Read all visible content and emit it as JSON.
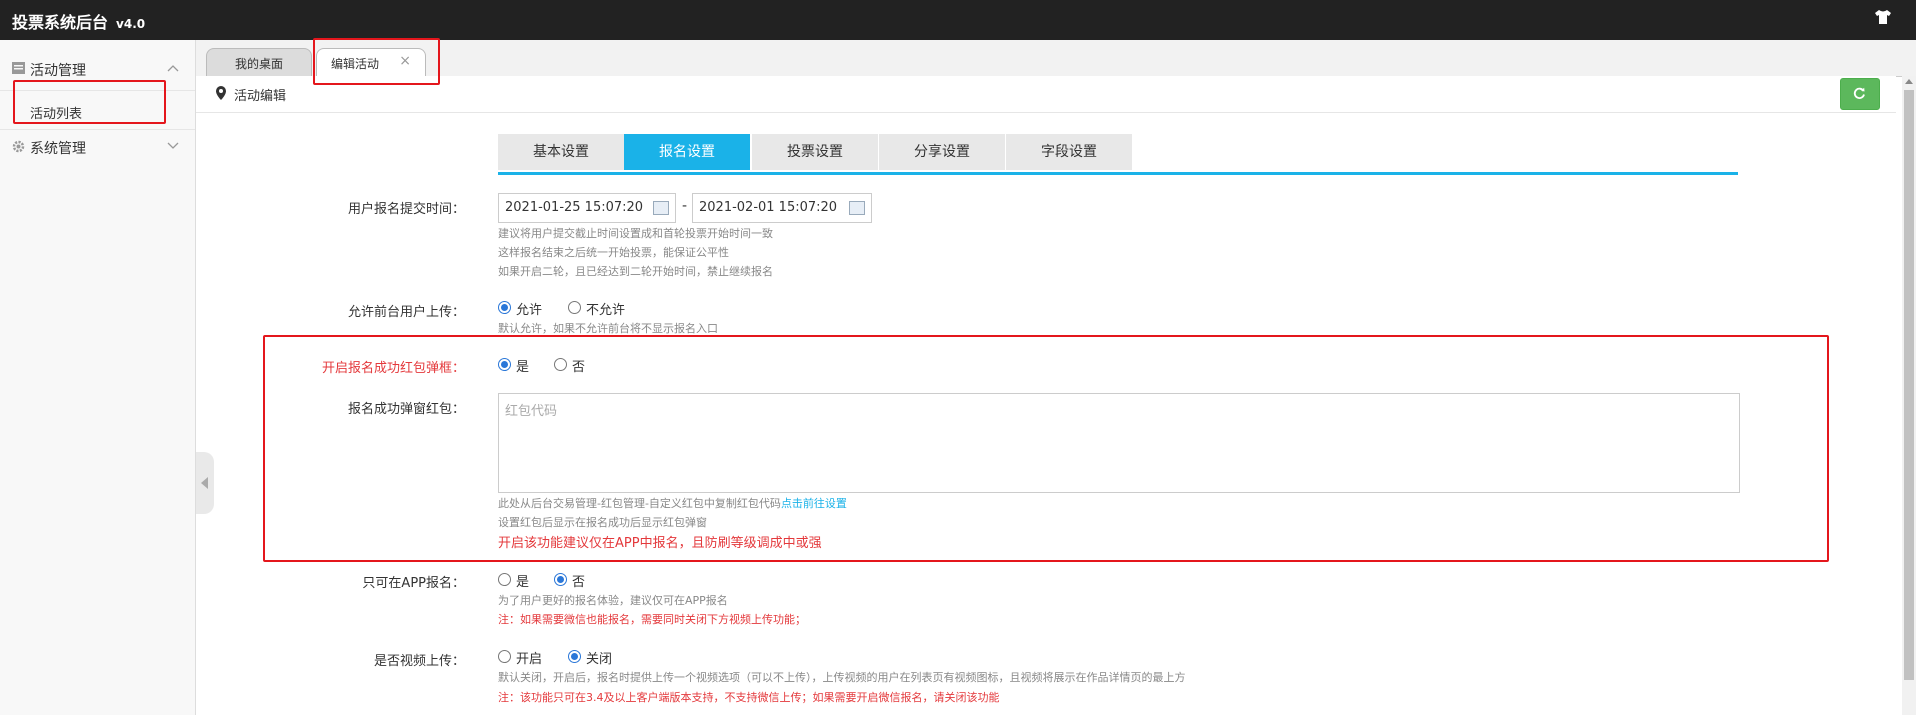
{
  "app": {
    "title": "投票系统后台",
    "version": "v4.0"
  },
  "sidebar": {
    "groups": [
      {
        "label": "活动管理",
        "items": [
          {
            "label": "活动列表"
          }
        ]
      },
      {
        "label": "系统管理"
      }
    ]
  },
  "tabs": [
    {
      "label": "我的桌面"
    },
    {
      "label": "编辑活动",
      "close": "×"
    }
  ],
  "page": {
    "breadcrumb": "活动编辑"
  },
  "section_tabs": [
    {
      "label": "基本设置",
      "active": false
    },
    {
      "label": "报名设置",
      "active": true
    },
    {
      "label": "投票设置",
      "active": false
    },
    {
      "label": "分享设置",
      "active": false
    },
    {
      "label": "字段设置",
      "active": false
    }
  ],
  "form": {
    "submit_time": {
      "label": "用户报名提交时间：",
      "start": "2021-01-25 15:07:20",
      "sep": "-",
      "end": "2021-02-01 15:07:20",
      "help": [
        "建议将用户提交截止时间设置成和首轮投票开始时间一致",
        "这样报名结束之后统一开始投票，能保证公平性",
        "如果开启二轮，且已经达到二轮开始时间，禁止继续报名"
      ]
    },
    "allow_upload": {
      "label": "允许前台用户上传：",
      "options": [
        "允许",
        "不允许"
      ],
      "selected": 0,
      "help": "默认允许，如果不允许前台将不显示报名入口"
    },
    "redpacket_popup": {
      "label": "开启报名成功红包弹框：",
      "options": [
        "是",
        "否"
      ],
      "selected": 0
    },
    "redpacket_code": {
      "label": "报名成功弹窗红包：",
      "placeholder": "红包代码",
      "help1_prefix": "此处从后台交易管理-红包管理-自定义红包中复制红包代码",
      "help1_link": "点击前往设置",
      "help2": "设置红包后显示在报名成功后显示红包弹窗",
      "warn": "开启该功能建议仅在APP中报名，且防刷等级调成中或强"
    },
    "app_only": {
      "label": "只可在APP报名：",
      "options": [
        "是",
        "否"
      ],
      "selected": 1,
      "help": "为了用户更好的报名体验，建议仅可在APP报名",
      "note": "注：如果需要微信也能报名，需要同时关闭下方视频上传功能；"
    },
    "video_upload": {
      "label": "是否视频上传：",
      "options": [
        "开启",
        "关闭"
      ],
      "selected": 1,
      "help": "默认关闭，开启后，报名时提供上传一个视频选项（可以不上传），上传视频的用户在列表页有视频图标，且视频将展示在作品详情页的最上方",
      "note": "注：该功能只可在3.4及以上客户端版本支持，不支持微信上传；如果需要开启微信报名，请关闭该功能"
    }
  },
  "colors": {
    "accent": "#1ab2e8",
    "topbar": "#222222",
    "success": "#5cb85c",
    "warning": "#e4393c"
  },
  "icons": [
    "tshirt-icon",
    "list-icon",
    "gear-icon",
    "chevron-up-icon",
    "chevron-down-icon",
    "map-pin-icon",
    "refresh-icon",
    "calendar-icon"
  ]
}
